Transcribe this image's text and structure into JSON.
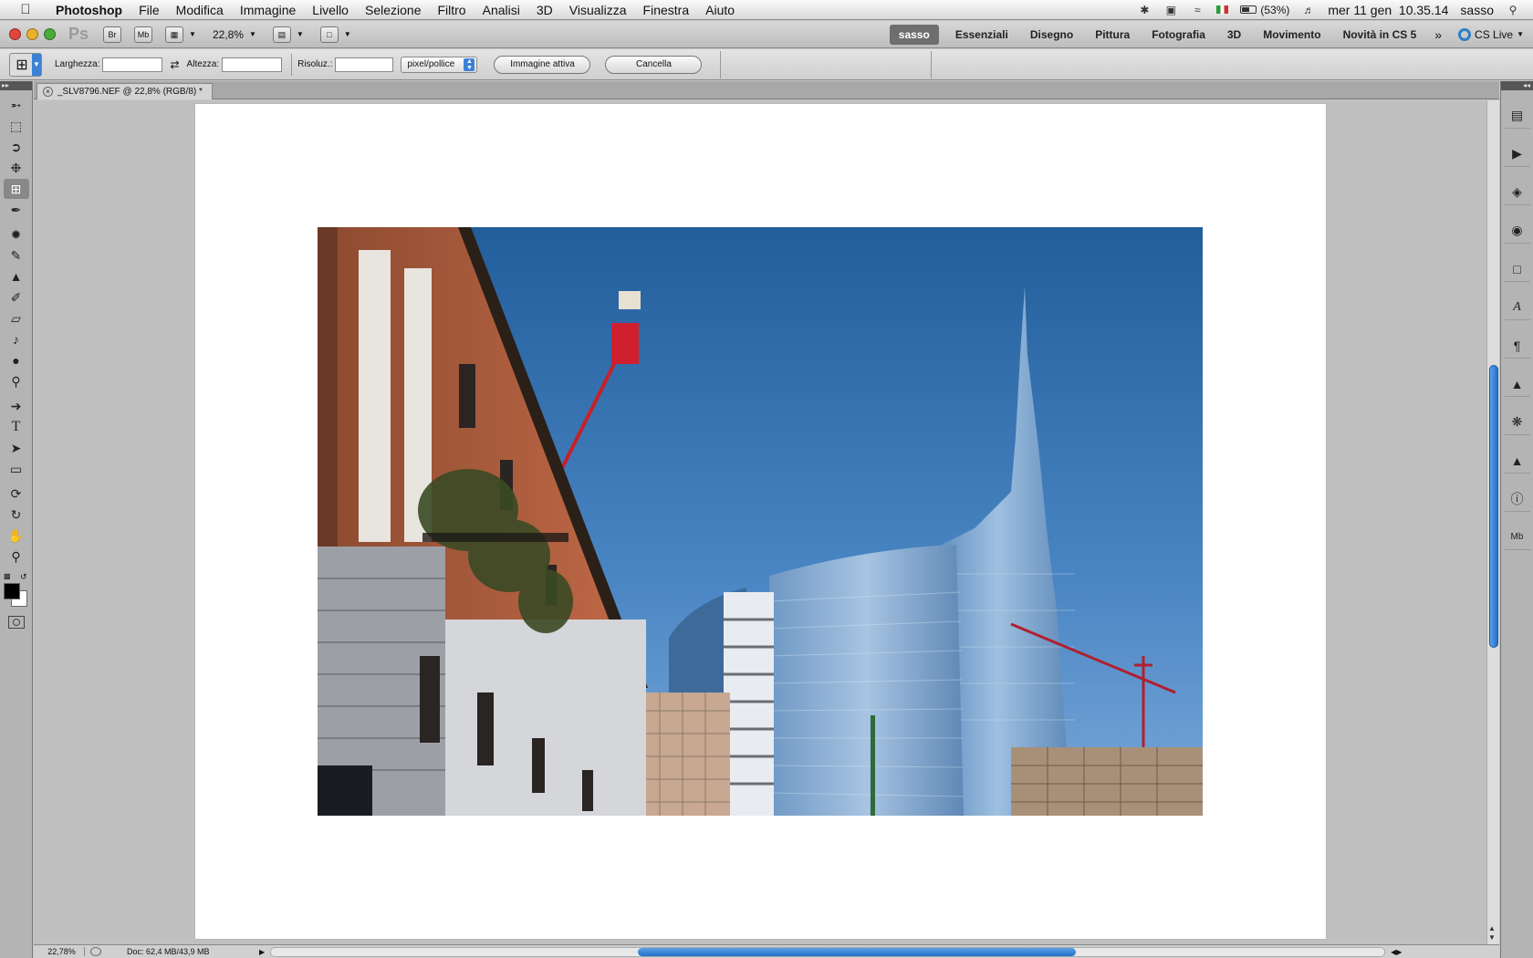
{
  "menubar": {
    "items": [
      "Photoshop",
      "File",
      "Modifica",
      "Immagine",
      "Livello",
      "Selezione",
      "Filtro",
      "Analisi",
      "3D",
      "Visualizza",
      "Finestra",
      "Aiuto"
    ],
    "battery": "(53%)",
    "clock": "mer 11 gen  10.35.14",
    "user": "sasso"
  },
  "appbar": {
    "logo": "Ps",
    "bridge": "Br",
    "minibridge": "Mb",
    "zoom": "22,8%",
    "workspaces": [
      "sasso",
      "Essenziali",
      "Disegno",
      "Pittura",
      "Fotografia",
      "3D",
      "Movimento",
      "Novità in CS 5"
    ],
    "active_workspace": "sasso",
    "cs_live": "CS Live"
  },
  "options": {
    "width_label": "Larghezza:",
    "height_label": "Altezza:",
    "resolution_label": "Risoluz.:",
    "unit": "pixel/pollice",
    "front_image": "Immagine attiva",
    "clear": "Cancella"
  },
  "document": {
    "tab_title": "_SLV8796.NEF @ 22,8% (RGB/8) *"
  },
  "status": {
    "zoom": "22,78%",
    "doc_info": "Doc: 62,4 MB/43,9 MB"
  },
  "colors": {
    "foreground": "#000000",
    "background": "#ffffff",
    "accent": "#3b82d6"
  }
}
